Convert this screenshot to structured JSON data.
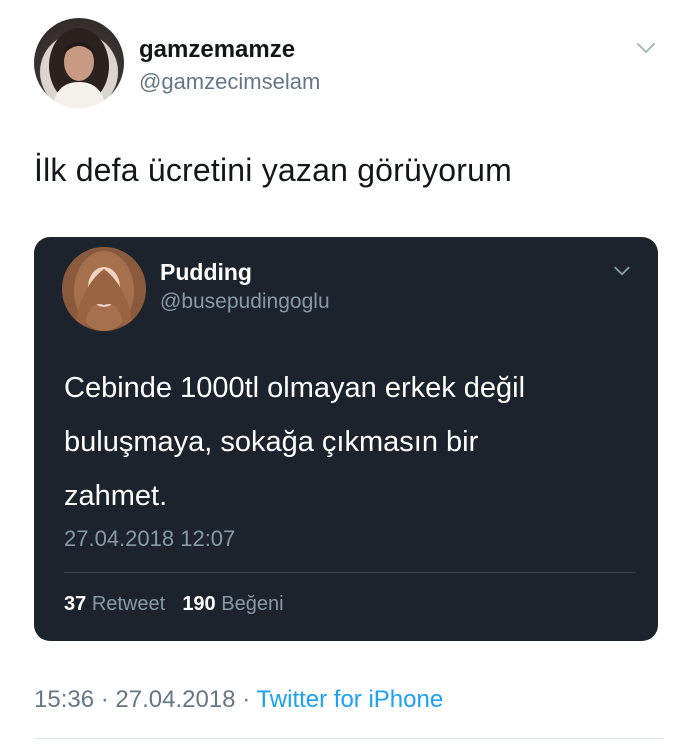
{
  "author": {
    "display_name": "gamzemamze",
    "handle": "@gamzecimselam"
  },
  "tweet": {
    "text": "İlk defa ücretini yazan görüyorum"
  },
  "quoted_tweet": {
    "display_name": "Pudding",
    "handle": "@busepudingoglu",
    "text_lines": [
      "Cebinde 1000tl olmayan erkek değil",
      "buluşmaya, sokağa çıkmasın bir",
      "zahmet."
    ],
    "timestamp": "27.04.2018 12:07",
    "retweets_count": "37",
    "retweets_label": "Retweet",
    "likes_count": "190",
    "likes_label": "Beğeni"
  },
  "footer": {
    "time": "15:36",
    "separator": "·",
    "date": "27.04.2018",
    "source": "Twitter for iPhone"
  },
  "colors": {
    "link_blue": "#1da1f2",
    "quote_bg": "#1d232c",
    "secondary_text": "#657786"
  },
  "icons": {
    "author_menu": "chevron-down-icon",
    "quote_menu": "chevron-down-icon"
  }
}
